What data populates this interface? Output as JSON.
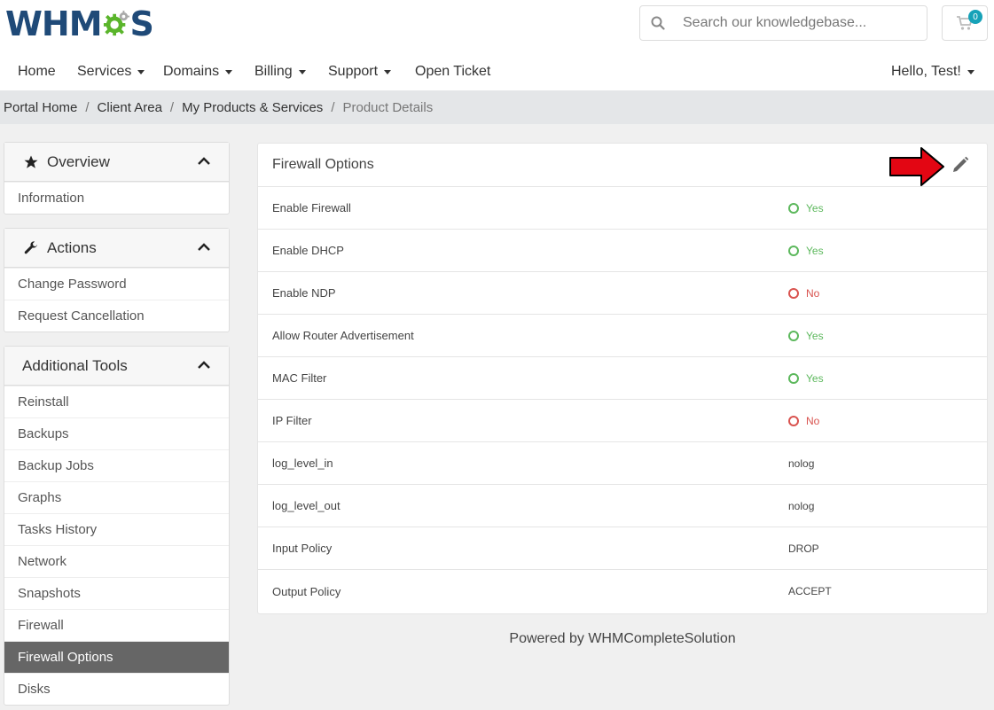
{
  "brand": {
    "logo_left": "WHM",
    "logo_right": "S",
    "logo_mid": "C"
  },
  "search": {
    "placeholder": "Search our knowledgebase..."
  },
  "cart": {
    "count": "0"
  },
  "nav": {
    "home": "Home",
    "services": "Services",
    "domains": "Domains",
    "billing": "Billing",
    "support": "Support",
    "open_ticket": "Open Ticket",
    "user": "Hello, Test!"
  },
  "breadcrumb": [
    "Portal Home",
    "Client Area",
    "My Products & Services",
    "Product Details"
  ],
  "sidebar": {
    "overview": {
      "title": "Overview",
      "items": [
        "Information"
      ]
    },
    "actions": {
      "title": "Actions",
      "items": [
        "Change Password",
        "Request Cancellation"
      ]
    },
    "tools": {
      "title": "Additional Tools",
      "items": [
        "Reinstall",
        "Backups",
        "Backup Jobs",
        "Graphs",
        "Tasks History",
        "Network",
        "Snapshots",
        "Firewall",
        "Firewall Options",
        "Disks"
      ],
      "active": "Firewall Options"
    }
  },
  "card": {
    "title": "Firewall Options",
    "rows": [
      {
        "label": "Enable Firewall",
        "value": "Yes",
        "status": "yes"
      },
      {
        "label": "Enable DHCP",
        "value": "Yes",
        "status": "yes"
      },
      {
        "label": "Enable NDP",
        "value": "No",
        "status": "no"
      },
      {
        "label": "Allow Router Advertisement",
        "value": "Yes",
        "status": "yes"
      },
      {
        "label": "MAC Filter",
        "value": "Yes",
        "status": "yes"
      },
      {
        "label": "IP Filter",
        "value": "No",
        "status": "no"
      },
      {
        "label": "log_level_in",
        "value": "nolog",
        "status": "plain"
      },
      {
        "label": "log_level_out",
        "value": "nolog",
        "status": "plain"
      },
      {
        "label": "Input Policy",
        "value": "DROP",
        "status": "plain"
      },
      {
        "label": "Output Policy",
        "value": "ACCEPT",
        "status": "plain"
      }
    ]
  },
  "footer": {
    "text": "Powered by WHMCompleteSolution"
  },
  "colors": {
    "brand_blue": "#1f4a78",
    "brand_green": "#5ab52b",
    "yes": "#5cb85c",
    "no": "#d9534f",
    "active": "#666666",
    "arrow": "#e30613"
  }
}
